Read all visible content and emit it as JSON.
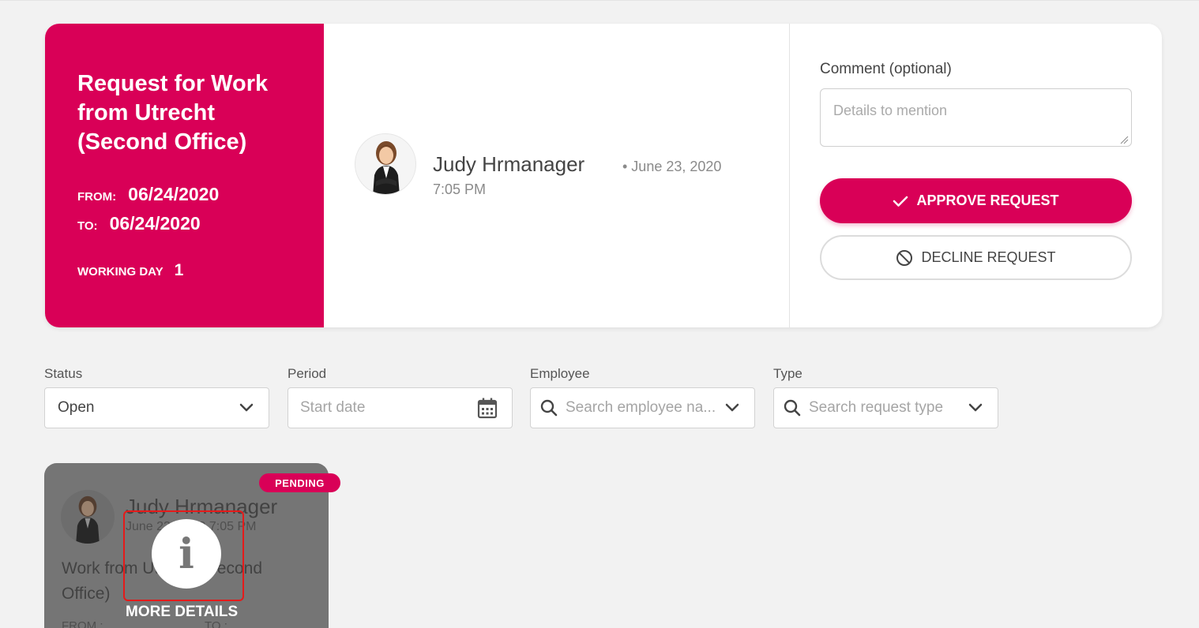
{
  "request": {
    "title": "Request for Work from Utrecht (Second Office)",
    "from_label": "FROM:",
    "from_date": "06/24/2020",
    "to_label": "TO:",
    "to_date": "06/24/2020",
    "working_day_label": "WORKING DAY",
    "working_day_value": "1",
    "requester_name": "Judy Hrmanager",
    "requested_date": "• June 23, 2020",
    "requested_time": "7:05 PM",
    "comment_label": "Comment (optional)",
    "comment_placeholder": "Details to mention",
    "approve_label": "APPROVE REQUEST",
    "decline_label": "DECLINE REQUEST",
    "accent_color": "#d90057"
  },
  "filters": {
    "status": {
      "label": "Status",
      "value": "Open"
    },
    "period": {
      "label": "Period",
      "placeholder": "Start date"
    },
    "employee": {
      "label": "Employee",
      "placeholder": "Search employee na..."
    },
    "type": {
      "label": "Type",
      "placeholder": "Search request type"
    }
  },
  "tile": {
    "badge": "PENDING",
    "name": "Judy Hrmanager",
    "date": "June 23, 2020 7:05 PM",
    "type": "Work from Utrecht (Second Office)",
    "from_label": "FROM :",
    "to_label": "TO :",
    "overlay_label": "MORE DETAILS",
    "info_icon": "info-icon"
  }
}
